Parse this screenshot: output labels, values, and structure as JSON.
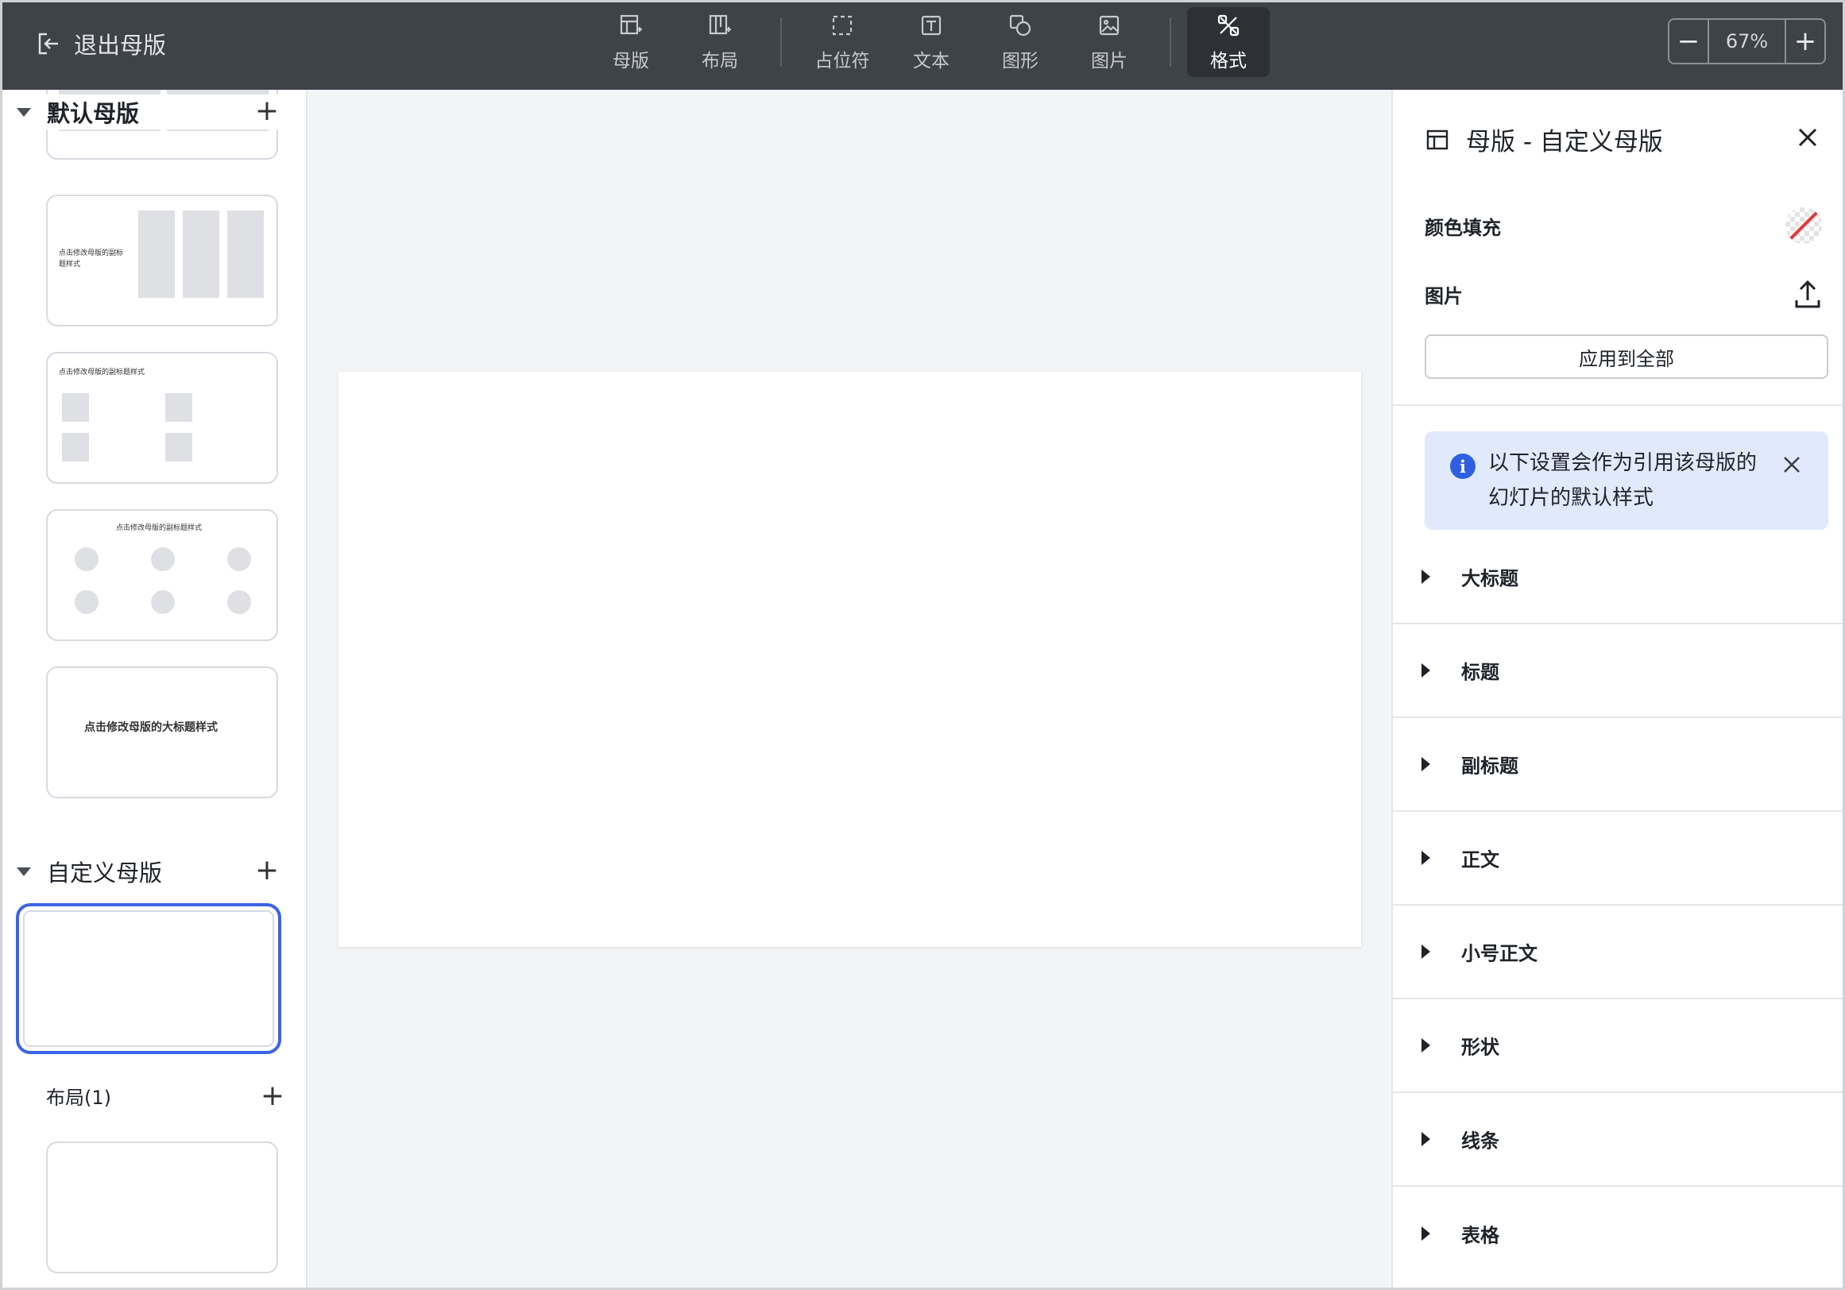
{
  "toolbar": {
    "exit_label": "退出母版",
    "tools": [
      {
        "label": "母版",
        "icon": "master-icon"
      },
      {
        "label": "布局",
        "icon": "layout-icon"
      },
      {
        "label": "占位符",
        "icon": "placeholder-icon"
      },
      {
        "label": "文本",
        "icon": "text-icon"
      },
      {
        "label": "图形",
        "icon": "shape-icon"
      },
      {
        "label": "图片",
        "icon": "image-icon"
      },
      {
        "label": "格式",
        "icon": "format-icon"
      }
    ],
    "zoom": {
      "minus": "−",
      "value": "67%",
      "plus": "+"
    }
  },
  "left_panel": {
    "default_section": {
      "title": "默认母版",
      "add": "+"
    },
    "custom_section": {
      "title": "自定义母版",
      "add": "+"
    },
    "layout_heading": "布局(1)",
    "layout_add": "+",
    "thumb_texts": {
      "subtitle_style": "点击修改母版的副标题样式",
      "subtitle_style_wrap_a": "点击修改母版的副标",
      "subtitle_style_wrap_b": "题样式",
      "title_style": "点击修改母版的大标题样式"
    }
  },
  "right_panel": {
    "title": "母版 - 自定义母版",
    "color_fill": "颜色填充",
    "image": "图片",
    "apply_all": "应用到全部",
    "info_text": "以下设置会作为引用该母版的幻灯片的默认样式",
    "sections": [
      "大标题",
      "标题",
      "副标题",
      "正文",
      "小号正文",
      "形状",
      "线条",
      "表格"
    ]
  },
  "colors": {
    "toolbar_bg": "#3e4249",
    "accent": "#3a64e6",
    "info_bg": "#e1e9fd",
    "canvas_bg": "#f3f4f6"
  }
}
